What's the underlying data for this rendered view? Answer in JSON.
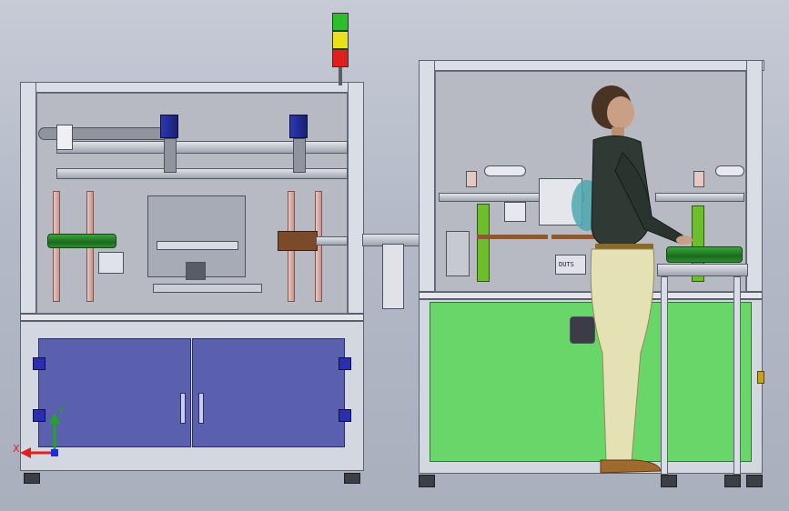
{
  "viewport": {
    "background": "#b6bcc8"
  },
  "axis_triad": {
    "x_label": "X",
    "y_label": "Y",
    "x_color": "#e0201c",
    "y_color": "#1ea81e",
    "z_color": "#1c2ae0"
  },
  "signal_tower": {
    "colors": [
      "#2cbf2c",
      "#e8e21c",
      "#e0201c"
    ]
  },
  "machine_left": {
    "door_color": "#5a5fae",
    "roller_color": "#2f9a31",
    "post_color": "#e1b2ab"
  },
  "machine_right": {
    "panel_color": "#69d66a",
    "label": "DUTS"
  },
  "operator": {
    "figure": "operator"
  }
}
